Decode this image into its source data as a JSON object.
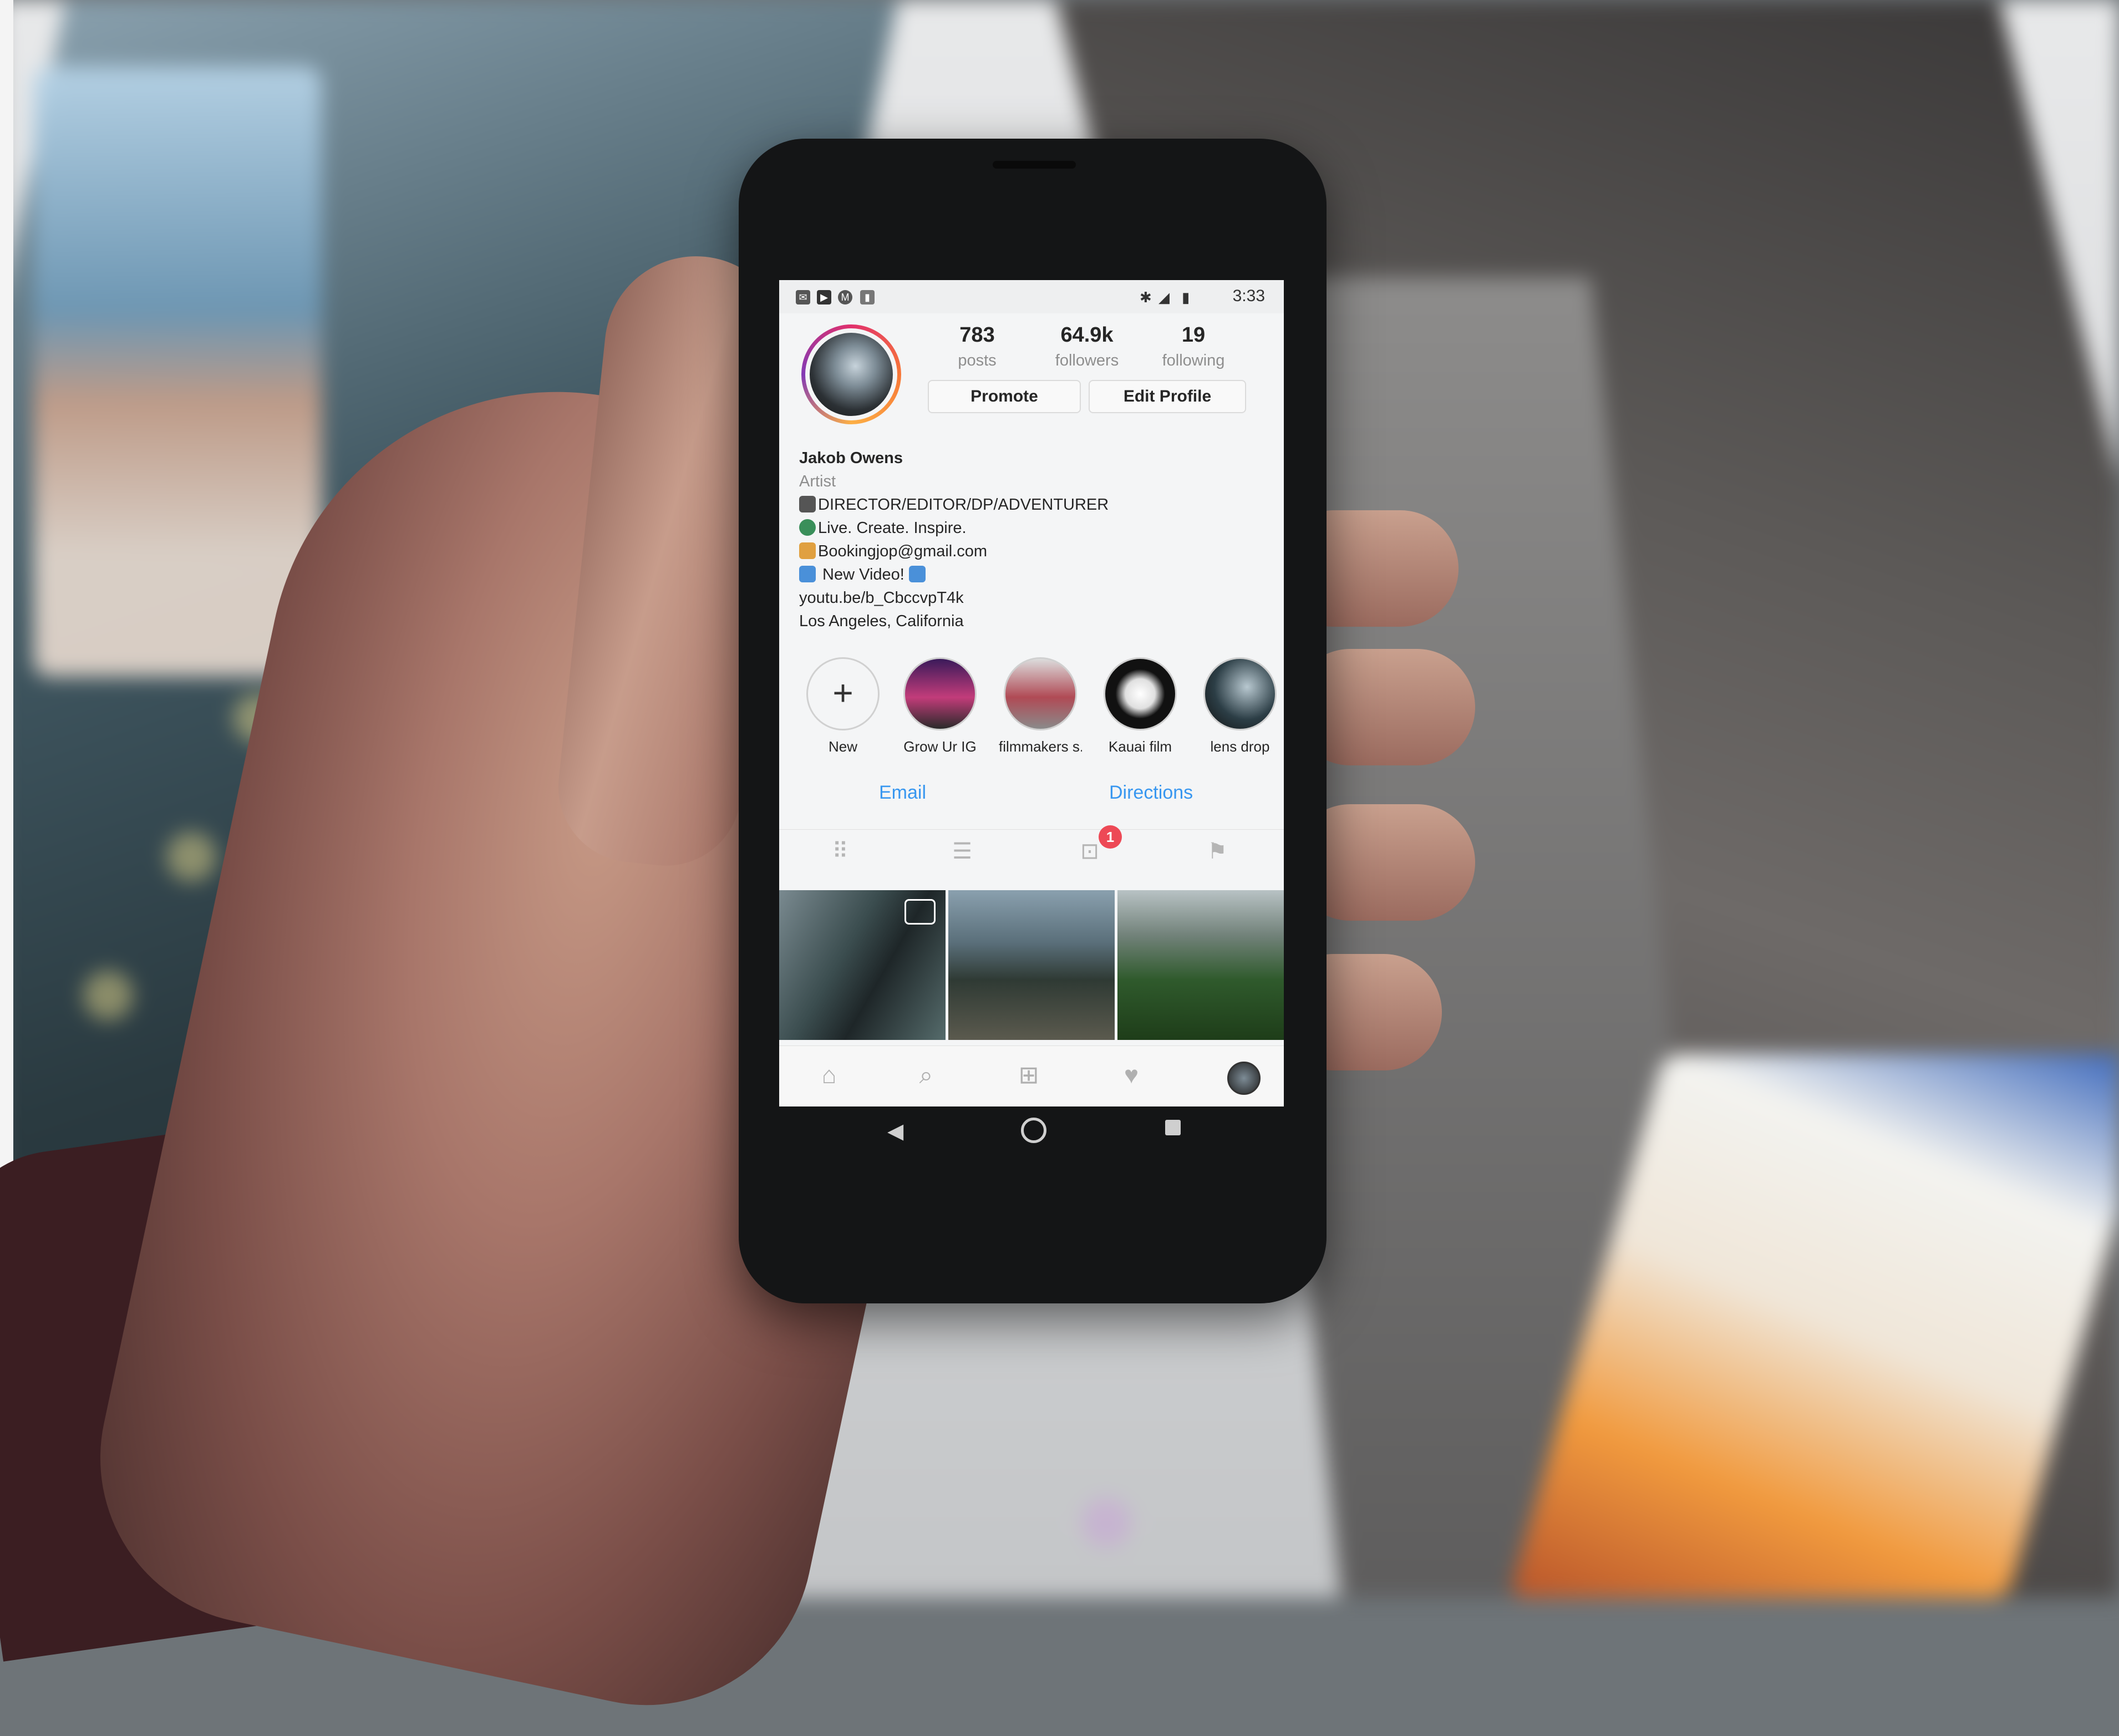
{
  "status_bar": {
    "time": "3:33"
  },
  "profile": {
    "posts": {
      "count": "783",
      "label": "posts"
    },
    "followers": {
      "count": "64.9k",
      "label": "followers"
    },
    "following": {
      "count": "19",
      "label": "following"
    },
    "promote_label": "Promote",
    "edit_profile_label": "Edit Profile",
    "name": "Jakob Owens",
    "category": "Artist",
    "bio_lines": [
      "DIRECTOR/EDITOR/DP/ADVENTURER",
      "Live. Create. Inspire.",
      "Bookingjop@gmail.com",
      " New Video! ",
      "youtu.be/b_CbccvpT4k",
      "Los Angeles, California"
    ]
  },
  "highlights": [
    {
      "label": "New",
      "icon": "plus-icon"
    },
    {
      "label": "Grow Ur IG",
      "color": "#6b2a7a"
    },
    {
      "label": "filmmakers s...",
      "color": "#b04a55"
    },
    {
      "label": "Kauai film",
      "color": "#1a1a1a"
    },
    {
      "label": "lens drop",
      "color": "#2c3e46"
    }
  ],
  "actions": {
    "email": "Email",
    "directions": "Directions"
  },
  "tabs": {
    "icons": [
      "grid-icon",
      "list-icon",
      "tagged-icon",
      "saved-icon"
    ],
    "tagged_badge": "1"
  },
  "bottom_nav": {
    "icons": [
      "home-icon",
      "search-icon",
      "add-post-icon",
      "heart-icon",
      "profile-icon"
    ]
  },
  "colors": {
    "link": "#3897f0",
    "badge": "#ed4956",
    "story_ring": "#e1306c"
  }
}
